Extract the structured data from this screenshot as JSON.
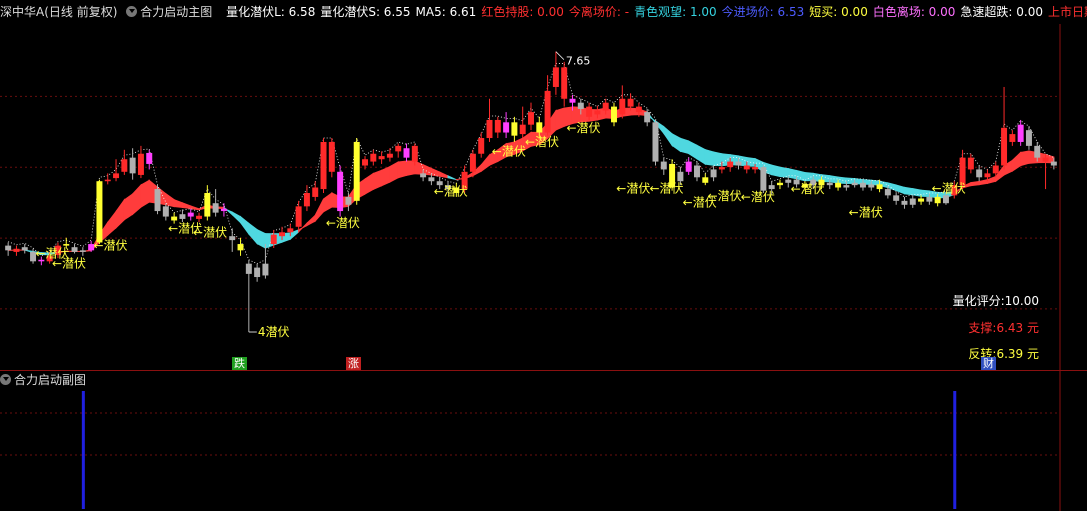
{
  "header": {
    "stock": "深中华A(日线 前复权)",
    "indicator": "合力启动主图",
    "items": [
      {
        "label": "量化潜伏L: 6.58",
        "color": "#ffffff"
      },
      {
        "label": "量化潜伏S: 6.55",
        "color": "#ffffff"
      },
      {
        "label": "MA5: 6.61",
        "color": "#ffffff"
      },
      {
        "label": "红色持股: 0.00",
        "color": "#ff3030"
      },
      {
        "label": "今离场价: -",
        "color": "#ff3030"
      },
      {
        "label": "青色观望: 1.00",
        "color": "#35d3e0"
      },
      {
        "label": "今进场价: 6.53",
        "color": "#4d5cff"
      },
      {
        "label": "短买: 0.00",
        "color": "#ffff40"
      },
      {
        "label": "白色离场: 0.00",
        "color": "#ff70ff"
      },
      {
        "label": "急速超跌: 0.00",
        "color": "#ffffff"
      },
      {
        "label": "上市日期:◇",
        "color": "#ff3030"
      }
    ]
  },
  "panel": {
    "score": "量化评分:10.00",
    "support": "支撑:6.43 元",
    "reversal": "反转:6.39 元",
    "score_color": "#ffffff",
    "support_color": "#ff3030",
    "reversal_color": "#ffff40"
  },
  "badges": {
    "die": "跌",
    "zhang": "涨",
    "cai": "财",
    "die_color": "#20a020",
    "zhang_color": "#c02020",
    "cai_color": "#3050c0"
  },
  "sub": {
    "title": "合力启动副图",
    "bar_color": "#2020e0"
  },
  "chart_data": {
    "type": "candlestick",
    "ylim": [
      3.8,
      7.9
    ],
    "max_label": "7.65",
    "min_label": "4潜伏",
    "signal_label": "←潜伏",
    "signal_marks": [
      {
        "i": 4,
        "v": 5.08
      },
      {
        "i": 6,
        "v": 4.95
      },
      {
        "i": 11,
        "v": 5.18
      },
      {
        "i": 20,
        "v": 5.4
      },
      {
        "i": 23,
        "v": 5.35
      },
      {
        "i": 39,
        "v": 5.47
      },
      {
        "i": 52,
        "v": 5.87
      },
      {
        "i": 59,
        "v": 6.38
      },
      {
        "i": 63,
        "v": 6.5
      },
      {
        "i": 68,
        "v": 6.68
      },
      {
        "i": 74,
        "v": 5.91
      },
      {
        "i": 78,
        "v": 5.91
      },
      {
        "i": 82,
        "v": 5.73
      },
      {
        "i": 85,
        "v": 5.81
      },
      {
        "i": 89,
        "v": 5.8
      },
      {
        "i": 95,
        "v": 5.9
      },
      {
        "i": 102,
        "v": 5.6
      },
      {
        "i": 112,
        "v": 5.91
      }
    ],
    "candles": [
      {
        "o": 5.18,
        "c": 5.12,
        "h": 5.22,
        "l": 5.05,
        "col": "gray"
      },
      {
        "o": 5.1,
        "c": 5.14,
        "h": 5.18,
        "l": 5.05,
        "col": "red"
      },
      {
        "o": 5.16,
        "c": 5.12,
        "h": 5.2,
        "l": 5.08,
        "col": "gray"
      },
      {
        "o": 5.1,
        "c": 4.98,
        "h": 5.14,
        "l": 4.95,
        "col": "gray"
      },
      {
        "o": 5.0,
        "c": 4.98,
        "h": 5.04,
        "l": 4.93,
        "col": "magenta"
      },
      {
        "o": 4.98,
        "c": 5.05,
        "h": 5.1,
        "l": 4.95,
        "col": "red"
      },
      {
        "o": 5.06,
        "c": 5.18,
        "h": 5.22,
        "l": 5.02,
        "col": "red"
      },
      {
        "o": 5.2,
        "c": 5.18,
        "h": 5.28,
        "l": 5.15,
        "col": "yellow"
      },
      {
        "o": 5.16,
        "c": 5.1,
        "h": 5.2,
        "l": 5.08,
        "col": "gray"
      },
      {
        "o": 5.12,
        "c": 5.1,
        "h": 5.16,
        "l": 5.05,
        "col": "gray"
      },
      {
        "o": 5.12,
        "c": 5.2,
        "h": 5.24,
        "l": 5.1,
        "col": "magenta"
      },
      {
        "o": 5.22,
        "c": 6.0,
        "h": 6.02,
        "l": 5.2,
        "col": "yellow"
      },
      {
        "o": 6.0,
        "c": 6.02,
        "h": 6.1,
        "l": 5.96,
        "col": "red"
      },
      {
        "o": 6.04,
        "c": 6.1,
        "h": 6.28,
        "l": 6.0,
        "col": "red"
      },
      {
        "o": 6.12,
        "c": 6.28,
        "h": 6.4,
        "l": 6.08,
        "col": "red"
      },
      {
        "o": 6.3,
        "c": 6.1,
        "h": 6.42,
        "l": 6.02,
        "col": "gray"
      },
      {
        "o": 6.08,
        "c": 6.35,
        "h": 6.45,
        "l": 6.04,
        "col": "red"
      },
      {
        "o": 6.36,
        "c": 6.22,
        "h": 6.4,
        "l": 6.15,
        "col": "magenta"
      },
      {
        "o": 5.9,
        "c": 5.62,
        "h": 5.95,
        "l": 5.58,
        "col": "gray"
      },
      {
        "o": 5.68,
        "c": 5.55,
        "h": 5.72,
        "l": 5.5,
        "col": "gray"
      },
      {
        "o": 5.55,
        "c": 5.5,
        "h": 5.6,
        "l": 5.46,
        "col": "yellow"
      },
      {
        "o": 5.52,
        "c": 5.58,
        "h": 5.64,
        "l": 5.48,
        "col": "gray"
      },
      {
        "o": 5.6,
        "c": 5.55,
        "h": 5.65,
        "l": 5.5,
        "col": "magenta"
      },
      {
        "o": 5.56,
        "c": 5.52,
        "h": 5.6,
        "l": 5.48,
        "col": "red"
      },
      {
        "o": 5.55,
        "c": 5.85,
        "h": 5.95,
        "l": 5.5,
        "col": "yellow"
      },
      {
        "o": 5.72,
        "c": 5.6,
        "h": 5.9,
        "l": 5.55,
        "col": "gray"
      },
      {
        "o": 5.62,
        "c": 5.65,
        "h": 5.72,
        "l": 5.55,
        "col": "magenta"
      },
      {
        "o": 5.3,
        "c": 5.25,
        "h": 5.4,
        "l": 5.1,
        "col": "gray"
      },
      {
        "o": 5.2,
        "c": 5.12,
        "h": 5.28,
        "l": 5.05,
        "col": "yellow"
      },
      {
        "o": 4.95,
        "c": 4.82,
        "h": 5.0,
        "l": 4.08,
        "col": "gray"
      },
      {
        "o": 4.9,
        "c": 4.78,
        "h": 4.95,
        "l": 4.72,
        "col": "gray"
      },
      {
        "o": 4.8,
        "c": 4.95,
        "h": 5.2,
        "l": 4.76,
        "col": "gray"
      },
      {
        "o": 5.2,
        "c": 5.32,
        "h": 5.38,
        "l": 5.15,
        "col": "red"
      },
      {
        "o": 5.3,
        "c": 5.35,
        "h": 5.42,
        "l": 5.25,
        "col": "red"
      },
      {
        "o": 5.35,
        "c": 5.4,
        "h": 5.46,
        "l": 5.3,
        "col": "red"
      },
      {
        "o": 5.42,
        "c": 5.68,
        "h": 5.75,
        "l": 5.38,
        "col": "red"
      },
      {
        "o": 5.68,
        "c": 5.85,
        "h": 5.95,
        "l": 5.62,
        "col": "red"
      },
      {
        "o": 5.8,
        "c": 5.92,
        "h": 6.0,
        "l": 5.75,
        "col": "red"
      },
      {
        "o": 5.9,
        "c": 6.5,
        "h": 6.55,
        "l": 5.85,
        "col": "red"
      },
      {
        "o": 6.5,
        "c": 6.12,
        "h": 6.55,
        "l": 6.05,
        "col": "red"
      },
      {
        "o": 6.12,
        "c": 5.62,
        "h": 6.2,
        "l": 5.55,
        "col": "magenta"
      },
      {
        "o": 5.7,
        "c": 5.8,
        "h": 5.85,
        "l": 5.62,
        "col": "gray"
      },
      {
        "o": 5.75,
        "c": 6.5,
        "h": 6.55,
        "l": 5.7,
        "col": "yellow"
      },
      {
        "o": 6.2,
        "c": 6.28,
        "h": 6.32,
        "l": 6.15,
        "col": "red"
      },
      {
        "o": 6.25,
        "c": 6.35,
        "h": 6.4,
        "l": 6.2,
        "col": "red"
      },
      {
        "o": 6.32,
        "c": 6.28,
        "h": 6.38,
        "l": 6.22,
        "col": "red"
      },
      {
        "o": 6.3,
        "c": 6.35,
        "h": 6.42,
        "l": 6.25,
        "col": "red"
      },
      {
        "o": 6.38,
        "c": 6.45,
        "h": 6.48,
        "l": 6.3,
        "col": "red"
      },
      {
        "o": 6.42,
        "c": 6.3,
        "h": 6.48,
        "l": 6.25,
        "col": "magenta"
      },
      {
        "o": 6.45,
        "c": 6.25,
        "h": 6.48,
        "l": 6.2,
        "col": "red"
      },
      {
        "o": 6.1,
        "c": 6.05,
        "h": 6.15,
        "l": 6.0,
        "col": "gray"
      },
      {
        "o": 6.05,
        "c": 6.0,
        "h": 6.1,
        "l": 5.95,
        "col": "gray"
      },
      {
        "o": 6.0,
        "c": 5.95,
        "h": 6.05,
        "l": 5.9,
        "col": "gray"
      },
      {
        "o": 5.95,
        "c": 5.9,
        "h": 6.0,
        "l": 5.85,
        "col": "gray"
      },
      {
        "o": 5.92,
        "c": 5.85,
        "h": 5.98,
        "l": 5.8,
        "col": "yellow"
      },
      {
        "o": 5.9,
        "c": 6.12,
        "h": 6.2,
        "l": 5.85,
        "col": "red"
      },
      {
        "o": 6.12,
        "c": 6.35,
        "h": 6.4,
        "l": 6.05,
        "col": "red"
      },
      {
        "o": 6.35,
        "c": 6.55,
        "h": 6.62,
        "l": 6.3,
        "col": "red"
      },
      {
        "o": 6.55,
        "c": 6.78,
        "h": 7.05,
        "l": 6.5,
        "col": "red"
      },
      {
        "o": 6.78,
        "c": 6.62,
        "h": 6.82,
        "l": 6.55,
        "col": "red"
      },
      {
        "o": 6.62,
        "c": 6.75,
        "h": 6.88,
        "l": 6.55,
        "col": "magenta"
      },
      {
        "o": 6.75,
        "c": 6.58,
        "h": 6.82,
        "l": 6.5,
        "col": "yellow"
      },
      {
        "o": 6.6,
        "c": 6.72,
        "h": 6.95,
        "l": 6.55,
        "col": "red"
      },
      {
        "o": 6.72,
        "c": 6.88,
        "h": 7.0,
        "l": 6.65,
        "col": "red"
      },
      {
        "o": 6.75,
        "c": 6.62,
        "h": 6.82,
        "l": 6.55,
        "col": "yellow"
      },
      {
        "o": 6.62,
        "c": 7.15,
        "h": 7.35,
        "l": 6.58,
        "col": "red"
      },
      {
        "o": 7.2,
        "c": 7.45,
        "h": 7.65,
        "l": 7.1,
        "col": "red"
      },
      {
        "o": 7.45,
        "c": 7.05,
        "h": 7.52,
        "l": 6.95,
        "col": "red"
      },
      {
        "o": 7.05,
        "c": 7.0,
        "h": 7.1,
        "l": 6.9,
        "col": "magenta"
      },
      {
        "o": 7.0,
        "c": 6.92,
        "h": 7.05,
        "l": 6.85,
        "col": "gray"
      },
      {
        "o": 6.95,
        "c": 6.82,
        "h": 7.0,
        "l": 6.78,
        "col": "red"
      },
      {
        "o": 6.85,
        "c": 6.9,
        "h": 6.96,
        "l": 6.8,
        "col": "red"
      },
      {
        "o": 6.9,
        "c": 7.0,
        "h": 7.05,
        "l": 6.85,
        "col": "red"
      },
      {
        "o": 6.95,
        "c": 6.75,
        "h": 7.0,
        "l": 6.7,
        "col": "yellow"
      },
      {
        "o": 6.85,
        "c": 7.05,
        "h": 7.22,
        "l": 6.8,
        "col": "red"
      },
      {
        "o": 7.05,
        "c": 6.95,
        "h": 7.12,
        "l": 6.9,
        "col": "red"
      },
      {
        "o": 6.95,
        "c": 6.88,
        "h": 7.0,
        "l": 6.82,
        "col": "red"
      },
      {
        "o": 6.88,
        "c": 6.75,
        "h": 6.92,
        "l": 6.7,
        "col": "gray"
      },
      {
        "o": 6.75,
        "c": 6.25,
        "h": 6.78,
        "l": 6.2,
        "col": "gray"
      },
      {
        "o": 6.25,
        "c": 6.15,
        "h": 6.3,
        "l": 6.08,
        "col": "gray"
      },
      {
        "o": 6.22,
        "c": 5.92,
        "h": 6.28,
        "l": 5.88,
        "col": "yellow"
      },
      {
        "o": 6.0,
        "c": 6.12,
        "h": 6.18,
        "l": 5.95,
        "col": "gray"
      },
      {
        "o": 6.12,
        "c": 6.25,
        "h": 6.3,
        "l": 6.08,
        "col": "magenta"
      },
      {
        "o": 6.2,
        "c": 6.05,
        "h": 6.25,
        "l": 6.0,
        "col": "gray"
      },
      {
        "o": 6.05,
        "c": 5.98,
        "h": 6.1,
        "l": 5.95,
        "col": "yellow"
      },
      {
        "o": 6.05,
        "c": 6.15,
        "h": 6.2,
        "l": 6.0,
        "col": "gray"
      },
      {
        "o": 6.15,
        "c": 6.18,
        "h": 6.25,
        "l": 6.1,
        "col": "red"
      },
      {
        "o": 6.18,
        "c": 6.25,
        "h": 6.3,
        "l": 6.12,
        "col": "red"
      },
      {
        "o": 6.25,
        "c": 6.2,
        "h": 6.3,
        "l": 6.15,
        "col": "gray"
      },
      {
        "o": 6.2,
        "c": 6.15,
        "h": 6.25,
        "l": 6.1,
        "col": "red"
      },
      {
        "o": 6.15,
        "c": 6.18,
        "h": 6.22,
        "l": 6.1,
        "col": "red"
      },
      {
        "o": 6.18,
        "c": 5.88,
        "h": 6.2,
        "l": 5.85,
        "col": "gray"
      },
      {
        "o": 5.9,
        "c": 5.95,
        "h": 6.0,
        "l": 5.82,
        "col": "gray"
      },
      {
        "o": 5.95,
        "c": 5.98,
        "h": 6.02,
        "l": 5.9,
        "col": "yellow"
      },
      {
        "o": 5.98,
        "c": 6.02,
        "h": 6.06,
        "l": 5.92,
        "col": "gray"
      },
      {
        "o": 6.02,
        "c": 5.96,
        "h": 6.06,
        "l": 5.92,
        "col": "gray"
      },
      {
        "o": 5.96,
        "c": 5.92,
        "h": 6.0,
        "l": 5.88,
        "col": "yellow"
      },
      {
        "o": 5.95,
        "c": 6.02,
        "h": 6.06,
        "l": 5.9,
        "col": "gray"
      },
      {
        "o": 6.02,
        "c": 5.95,
        "h": 6.06,
        "l": 5.9,
        "col": "yellow"
      },
      {
        "o": 5.95,
        "c": 5.98,
        "h": 6.02,
        "l": 5.9,
        "col": "gray"
      },
      {
        "o": 5.98,
        "c": 5.92,
        "h": 6.02,
        "l": 5.88,
        "col": "yellow"
      },
      {
        "o": 5.92,
        "c": 5.95,
        "h": 6.0,
        "l": 5.88,
        "col": "gray"
      },
      {
        "o": 5.95,
        "c": 5.98,
        "h": 6.02,
        "l": 5.92,
        "col": "gray"
      },
      {
        "o": 5.98,
        "c": 5.92,
        "h": 6.02,
        "l": 5.88,
        "col": "gray"
      },
      {
        "o": 5.92,
        "c": 5.96,
        "h": 6.0,
        "l": 5.88,
        "col": "gray"
      },
      {
        "o": 5.96,
        "c": 5.9,
        "h": 6.02,
        "l": 5.86,
        "col": "yellow"
      },
      {
        "o": 5.9,
        "c": 5.82,
        "h": 5.94,
        "l": 5.78,
        "col": "gray"
      },
      {
        "o": 5.82,
        "c": 5.75,
        "h": 5.86,
        "l": 5.7,
        "col": "gray"
      },
      {
        "o": 5.75,
        "c": 5.7,
        "h": 5.8,
        "l": 5.65,
        "col": "gray"
      },
      {
        "o": 5.7,
        "c": 5.78,
        "h": 5.82,
        "l": 5.66,
        "col": "gray"
      },
      {
        "o": 5.78,
        "c": 5.74,
        "h": 5.82,
        "l": 5.7,
        "col": "yellow"
      },
      {
        "o": 5.74,
        "c": 5.8,
        "h": 5.84,
        "l": 5.7,
        "col": "gray"
      },
      {
        "o": 5.8,
        "c": 5.72,
        "h": 5.84,
        "l": 5.68,
        "col": "yellow"
      },
      {
        "o": 5.72,
        "c": 5.82,
        "h": 5.86,
        "l": 5.7,
        "col": "gray"
      },
      {
        "o": 5.82,
        "c": 5.95,
        "h": 6.0,
        "l": 5.78,
        "col": "red"
      },
      {
        "o": 5.95,
        "c": 6.3,
        "h": 6.4,
        "l": 5.9,
        "col": "red"
      },
      {
        "o": 6.3,
        "c": 6.15,
        "h": 6.35,
        "l": 6.1,
        "col": "red"
      },
      {
        "o": 6.15,
        "c": 6.05,
        "h": 6.2,
        "l": 6.0,
        "col": "gray"
      },
      {
        "o": 6.05,
        "c": 6.1,
        "h": 6.15,
        "l": 6.0,
        "col": "red"
      },
      {
        "o": 6.1,
        "c": 6.2,
        "h": 6.25,
        "l": 6.05,
        "col": "red"
      },
      {
        "o": 6.2,
        "c": 6.68,
        "h": 7.2,
        "l": 6.15,
        "col": "red"
      },
      {
        "o": 6.6,
        "c": 6.5,
        "h": 6.65,
        "l": 6.45,
        "col": "red"
      },
      {
        "o": 6.5,
        "c": 6.72,
        "h": 6.78,
        "l": 6.45,
        "col": "magenta"
      },
      {
        "o": 6.65,
        "c": 6.45,
        "h": 6.7,
        "l": 6.4,
        "col": "gray"
      },
      {
        "o": 6.45,
        "c": 6.3,
        "h": 6.5,
        "l": 6.25,
        "col": "gray"
      },
      {
        "o": 6.3,
        "c": 6.25,
        "h": 6.35,
        "l": 5.9,
        "col": "red"
      },
      {
        "o": 6.25,
        "c": 6.2,
        "h": 6.3,
        "l": 6.15,
        "col": "gray"
      }
    ],
    "sub_series": {
      "name": "",
      "markers": [
        {
          "i": 9,
          "v": 1.0
        },
        {
          "i": 114,
          "v": 1.0
        }
      ]
    }
  }
}
